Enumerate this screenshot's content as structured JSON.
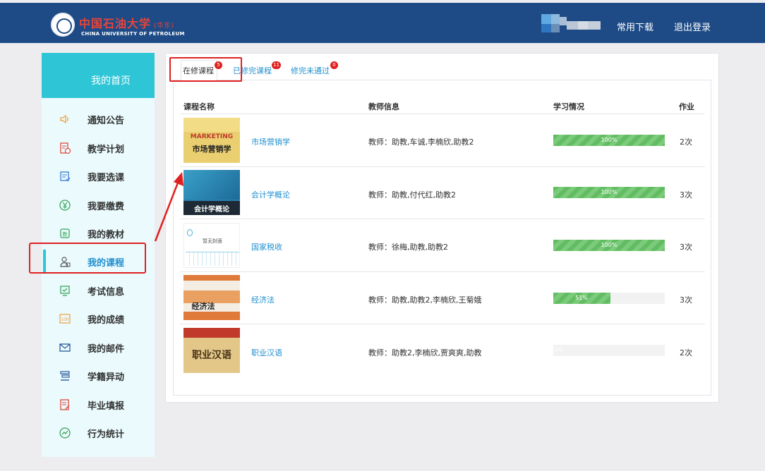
{
  "header": {
    "logo_cn": "中国石油大学",
    "logo_cn_sub": "(华东)",
    "logo_en": "CHINA UNIVERSITY OF PETROLEUM",
    "links": [
      "常用下载",
      "退出登录"
    ]
  },
  "sidebar": {
    "home_label": "我的首页",
    "items": [
      {
        "label": "通知公告",
        "icon": "speaker-icon"
      },
      {
        "label": "教学计划",
        "icon": "plan-icon"
      },
      {
        "label": "我要选课",
        "icon": "select-course-icon"
      },
      {
        "label": "我要缴费",
        "icon": "yuan-coin-icon"
      },
      {
        "label": "我的教材",
        "icon": "textbook-icon"
      },
      {
        "label": "我的课程",
        "icon": "user-course-icon",
        "active": true
      },
      {
        "label": "考试信息",
        "icon": "exam-icon"
      },
      {
        "label": "我的成绩",
        "icon": "score-icon"
      },
      {
        "label": "我的邮件",
        "icon": "mail-icon"
      },
      {
        "label": "学籍异动",
        "icon": "record-change-icon"
      },
      {
        "label": "毕业填报",
        "icon": "graduation-form-icon"
      },
      {
        "label": "行为统计",
        "icon": "stats-icon"
      }
    ]
  },
  "tabs": [
    {
      "label": "在修课程",
      "count": "5",
      "active": true
    },
    {
      "label": "已修完课程",
      "count": "11"
    },
    {
      "label": "修完未通过",
      "count": "0"
    }
  ],
  "table": {
    "headers": [
      "课程名称",
      "教师信息",
      "学习情况",
      "作业"
    ],
    "rows": [
      {
        "name": "市场营销学",
        "cover_text": "市场营销学",
        "cover_title": "MARKETING",
        "teacher": "教师：助教,车诚,李楠欣,助教2",
        "progress": 100,
        "progress_label": "100%",
        "homework": "2次"
      },
      {
        "name": "会计学概论",
        "cover_text": "会计学概论",
        "teacher": "教师：助教,付代红,助教2",
        "progress": 100,
        "progress_label": "100%",
        "homework": "3次"
      },
      {
        "name": "国家税收",
        "cover_text": "暂无封面",
        "teacher": "教师：徐梅,助教,助教2",
        "progress": 100,
        "progress_label": "100%",
        "homework": "3次"
      },
      {
        "name": "经济法",
        "cover_text": "经济法",
        "teacher": "教师：助教,助教2,李楠欣,王菊娥",
        "progress": 51,
        "progress_label": "51%",
        "homework": "3次"
      },
      {
        "name": "职业汉语",
        "cover_text": "职业汉语",
        "teacher": "教师：助教2,李楠欣,贾爽爽,助教",
        "progress": 0,
        "progress_label": "0%",
        "homework": "2次"
      }
    ]
  },
  "colors": {
    "header_bg": "#1e4b86",
    "sidebar_home": "#2ec6d6",
    "link": "#1f8fd0",
    "progress": "#62bd62",
    "highlight": "#e02020"
  }
}
